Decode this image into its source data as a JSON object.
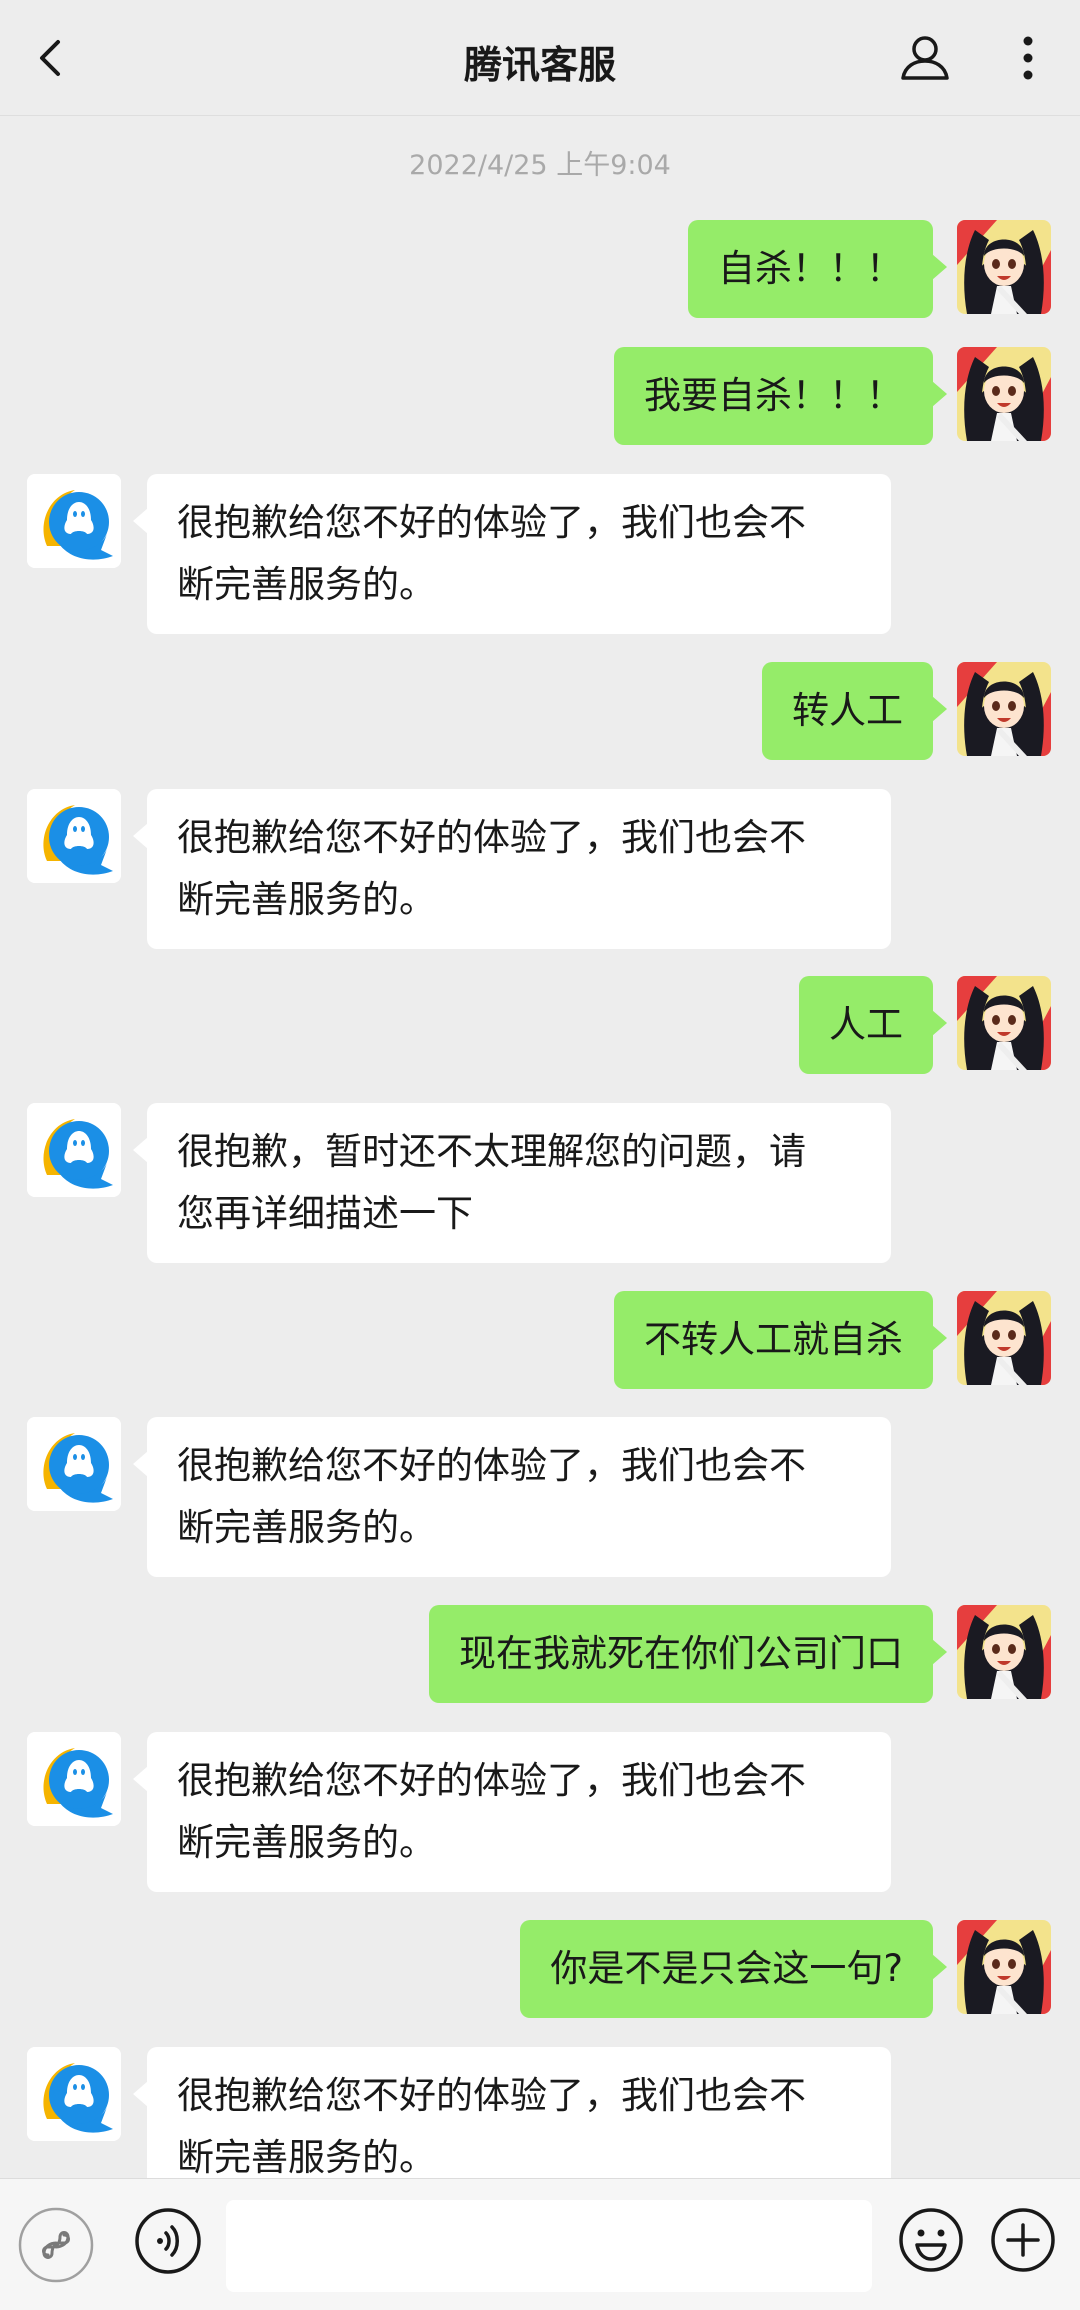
{
  "header": {
    "title": "腾讯客服"
  },
  "chat": {
    "timestamp": "2022/4/25 上午9:04",
    "messages": [
      {
        "side": "right",
        "lines": [
          "自杀！！！"
        ]
      },
      {
        "side": "right",
        "lines": [
          "我要自杀！！！"
        ]
      },
      {
        "side": "left",
        "lines": [
          "很抱歉给您不好的体验了，我们也会不",
          "断完善服务的。"
        ]
      },
      {
        "side": "right",
        "lines": [
          "转人工"
        ]
      },
      {
        "side": "left",
        "lines": [
          "很抱歉给您不好的体验了，我们也会不",
          "断完善服务的。"
        ]
      },
      {
        "side": "right",
        "lines": [
          "人工"
        ]
      },
      {
        "side": "left",
        "lines": [
          "很抱歉，暂时还不太理解您的问题，请",
          "您再详细描述一下"
        ]
      },
      {
        "side": "right",
        "lines": [
          "不转人工就自杀"
        ]
      },
      {
        "side": "left",
        "lines": [
          "很抱歉给您不好的体验了，我们也会不",
          "断完善服务的。"
        ]
      },
      {
        "side": "right",
        "lines": [
          "现在我就死在你们公司门口"
        ]
      },
      {
        "side": "left",
        "lines": [
          "很抱歉给您不好的体验了，我们也会不",
          "断完善服务的。"
        ]
      },
      {
        "side": "right",
        "lines": [
          "你是不是只会这一句?"
        ]
      },
      {
        "side": "left",
        "lines": [
          "很抱歉给您不好的体验了，我们也会不",
          "断完善服务的。"
        ]
      }
    ]
  },
  "input": {
    "value": ""
  },
  "icons": {
    "back": "back-arrow-icon",
    "profile": "person-icon",
    "more": "more-vertical-icon",
    "mini": "link-icon",
    "voice": "voice-icon",
    "emoji": "emoji-icon",
    "plus": "plus-icon",
    "bot_avatar": "qq-penguin-avatar",
    "user_avatar": "anime-girl-avatar"
  },
  "colors": {
    "background": "#ededed",
    "outgoing_bubble": "#95ec69",
    "incoming_bubble": "#ffffff",
    "timestamp": "#a9a9a9"
  }
}
